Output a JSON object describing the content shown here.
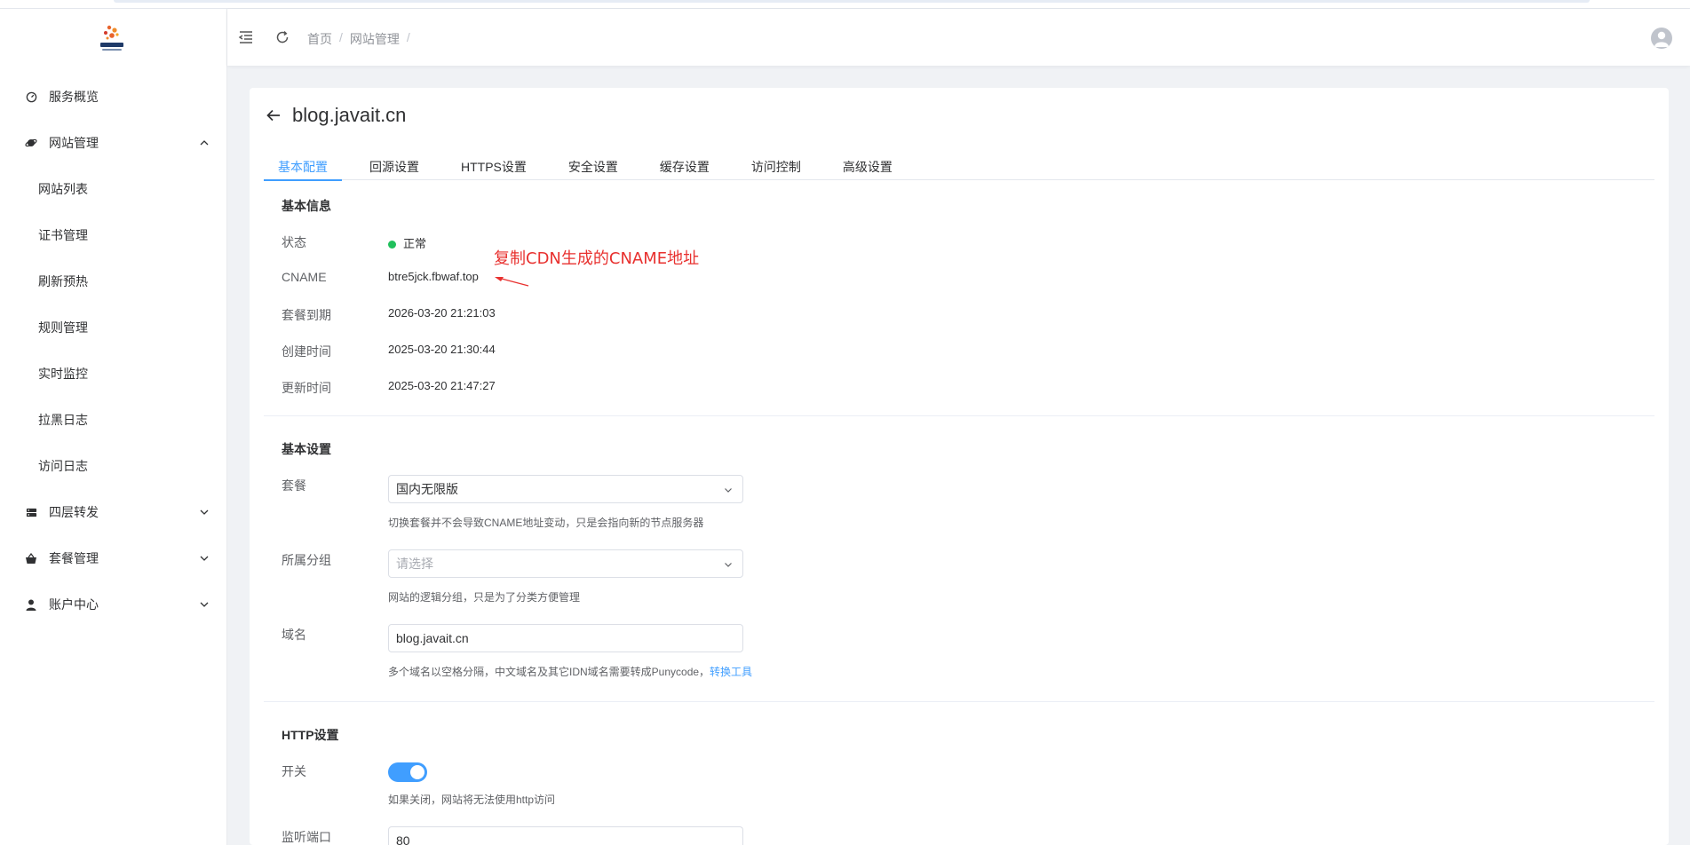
{
  "breadcrumbs": [
    "首页",
    "网站管理"
  ],
  "sidebar": {
    "items": [
      {
        "label": "服务概览",
        "icon": "dashboard-icon"
      },
      {
        "label": "网站管理",
        "icon": "globe-icon",
        "expanded": true
      },
      {
        "label": "网站列表",
        "sub": true
      },
      {
        "label": "证书管理",
        "sub": true
      },
      {
        "label": "刷新预热",
        "sub": true
      },
      {
        "label": "规则管理",
        "sub": true
      },
      {
        "label": "实时监控",
        "sub": true
      },
      {
        "label": "拉黑日志",
        "sub": true
      },
      {
        "label": "访问日志",
        "sub": true
      },
      {
        "label": "四层转发",
        "icon": "server-icon"
      },
      {
        "label": "套餐管理",
        "icon": "basket-icon"
      },
      {
        "label": "账户中心",
        "icon": "user-icon"
      }
    ]
  },
  "page": {
    "title": "blog.javait.cn",
    "tabs": [
      "基本配置",
      "回源设置",
      "HTTPS设置",
      "安全设置",
      "缓存设置",
      "访问控制",
      "高级设置"
    ],
    "active_tab": "基本配置"
  },
  "basic_info": {
    "section": "基本信息",
    "status_label": "状态",
    "status_value": "正常",
    "status_color": "#20c05c",
    "cname_label": "CNAME",
    "cname_value": "btre5jck.fbwaf.top",
    "expire_label": "套餐到期",
    "expire_value": "2026-03-20 21:21:03",
    "created_label": "创建时间",
    "created_value": "2025-03-20 21:30:44",
    "updated_label": "更新时间",
    "updated_value": "2025-03-20 21:47:27"
  },
  "annotation": "复制CDN生成的CNAME地址",
  "basic_settings": {
    "section": "基本设置",
    "plan_label": "套餐",
    "plan_value": "国内无限版",
    "plan_hint": "切换套餐并不会导致CNAME地址变动，只是会指向新的节点服务器",
    "group_label": "所属分组",
    "group_placeholder": "请选择",
    "group_hint": "网站的逻辑分组，只是为了分类方便管理",
    "domain_label": "域名",
    "domain_value": "blog.javait.cn",
    "domain_hint": "多个域名以空格分隔，中文域名及其它IDN域名需要转成Punycode，",
    "domain_hint_link": "转换工具"
  },
  "http_settings": {
    "section": "HTTP设置",
    "switch_label": "开关",
    "switch_on": true,
    "switch_hint": "如果关闭，网站将无法使用http访问",
    "port_label": "监听端口",
    "port_value": "80"
  },
  "colors": {
    "accent": "#409eff",
    "annotation": "#e8312f"
  }
}
